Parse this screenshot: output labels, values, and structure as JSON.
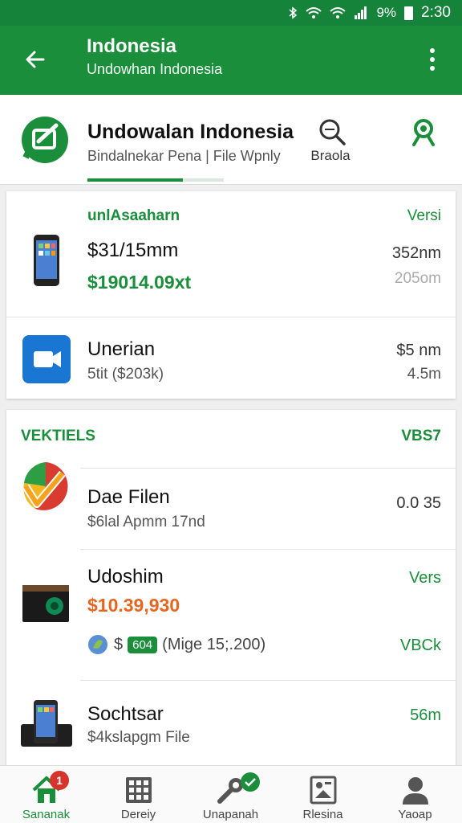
{
  "status_bar": {
    "battery": "9%",
    "time": "2:30"
  },
  "app_bar": {
    "title": "Indonesia",
    "subtitle": "Undowhan Indonesia"
  },
  "header": {
    "title": "Undowalan Indonesia",
    "subtitle": "Bindalnekar Pena | File Wpnly",
    "search_label": "Braola"
  },
  "section1": {
    "label": "unlAsaaharn",
    "right_label": "Versi",
    "rows": [
      {
        "title": "$31/15mm",
        "price": "$19014.09xt",
        "right_top": "352nm",
        "right_bottom": "205om"
      },
      {
        "title": "Unerian",
        "sub": "5tit ($203k)",
        "right_top": "$5 nm",
        "right_bottom": "4.5m"
      }
    ]
  },
  "section2": {
    "label": "VEKTIELS",
    "right_label": "VBS7",
    "rows": [
      {
        "title": "Dae Filen",
        "sub": "$6lal Apmm 17nd",
        "right": "0.0 35"
      },
      {
        "title": "Udoshim",
        "price": "$10.39,930",
        "tag_prefix": "$",
        "tag": "604",
        "tag_detail": "(Mige 15;.200)",
        "right_top": "Vers",
        "right_bottom": "VBCk"
      },
      {
        "title": "Sochtsar",
        "sub": "$4kslapgm File",
        "right": "56m"
      }
    ]
  },
  "bottom_nav": [
    {
      "label": "Sananak",
      "icon": "home-icon",
      "badge": "1"
    },
    {
      "label": "Dereiy",
      "icon": "grid-icon"
    },
    {
      "label": "Unapanah",
      "icon": "tools-icon"
    },
    {
      "label": "Rlesina",
      "icon": "document-icon"
    },
    {
      "label": "Yaoap",
      "icon": "person-icon"
    }
  ],
  "colors": {
    "primary": "#1a8e3a",
    "accent_orange": "#e8651f",
    "badge_red": "#d6332a"
  }
}
